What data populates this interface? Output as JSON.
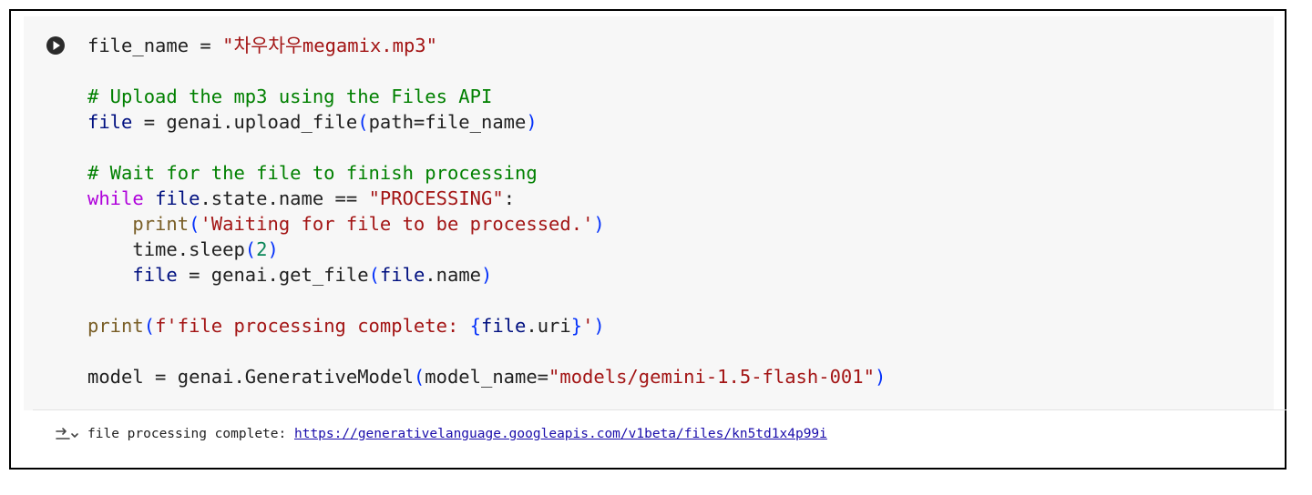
{
  "cell": {
    "code_lines": [
      {
        "tokens": [
          {
            "t": "file_name = ",
            "c": ""
          },
          {
            "t": "\"차우차우megamix.mp3\"",
            "c": "str"
          }
        ]
      },
      {
        "tokens": []
      },
      {
        "tokens": [
          {
            "t": "# Upload the mp3 using the Files API",
            "c": "com"
          }
        ]
      },
      {
        "tokens": [
          {
            "t": "file",
            "c": "var"
          },
          {
            "t": " = genai.upload_file",
            "c": ""
          },
          {
            "t": "(",
            "c": "brk"
          },
          {
            "t": "path=file_name",
            "c": ""
          },
          {
            "t": ")",
            "c": "brk"
          }
        ]
      },
      {
        "tokens": []
      },
      {
        "tokens": [
          {
            "t": "# Wait for the file to finish processing",
            "c": "com"
          }
        ]
      },
      {
        "tokens": [
          {
            "t": "while",
            "c": "kw"
          },
          {
            "t": " ",
            "c": ""
          },
          {
            "t": "file",
            "c": "var"
          },
          {
            "t": ".state.name == ",
            "c": ""
          },
          {
            "t": "\"PROCESSING\"",
            "c": "str"
          },
          {
            "t": ":",
            "c": ""
          }
        ]
      },
      {
        "tokens": [
          {
            "t": "    ",
            "c": ""
          },
          {
            "t": "print",
            "c": "fn"
          },
          {
            "t": "(",
            "c": "brk"
          },
          {
            "t": "'Waiting for file to be processed.'",
            "c": "str"
          },
          {
            "t": ")",
            "c": "brk"
          }
        ]
      },
      {
        "tokens": [
          {
            "t": "    time.sleep",
            "c": ""
          },
          {
            "t": "(",
            "c": "brk"
          },
          {
            "t": "2",
            "c": "num"
          },
          {
            "t": ")",
            "c": "brk"
          }
        ]
      },
      {
        "tokens": [
          {
            "t": "    ",
            "c": ""
          },
          {
            "t": "file",
            "c": "var"
          },
          {
            "t": " = genai.get_file",
            "c": ""
          },
          {
            "t": "(",
            "c": "brk"
          },
          {
            "t": "file",
            "c": "var"
          },
          {
            "t": ".name",
            "c": ""
          },
          {
            "t": ")",
            "c": "brk"
          }
        ]
      },
      {
        "tokens": []
      },
      {
        "tokens": [
          {
            "t": "print",
            "c": "fn"
          },
          {
            "t": "(",
            "c": "brk"
          },
          {
            "t": "f'file processing complete: ",
            "c": "str"
          },
          {
            "t": "{",
            "c": "brk"
          },
          {
            "t": "file",
            "c": "var"
          },
          {
            "t": ".uri",
            "c": ""
          },
          {
            "t": "}",
            "c": "brk"
          },
          {
            "t": "'",
            "c": "str"
          },
          {
            "t": ")",
            "c": "brk"
          }
        ]
      },
      {
        "tokens": []
      },
      {
        "tokens": [
          {
            "t": "model = genai.GenerativeModel",
            "c": ""
          },
          {
            "t": "(",
            "c": "brk"
          },
          {
            "t": "model_name=",
            "c": ""
          },
          {
            "t": "\"models/gemini-1.5-flash-001\"",
            "c": "str"
          },
          {
            "t": ")",
            "c": "brk"
          }
        ]
      }
    ]
  },
  "output": {
    "prefix": "file processing complete: ",
    "link": "https://generativelanguage.googleapis.com/v1beta/files/kn5td1x4p99i"
  },
  "icons": {
    "run": "play-circle-icon",
    "output": "output-collapse-icon"
  }
}
